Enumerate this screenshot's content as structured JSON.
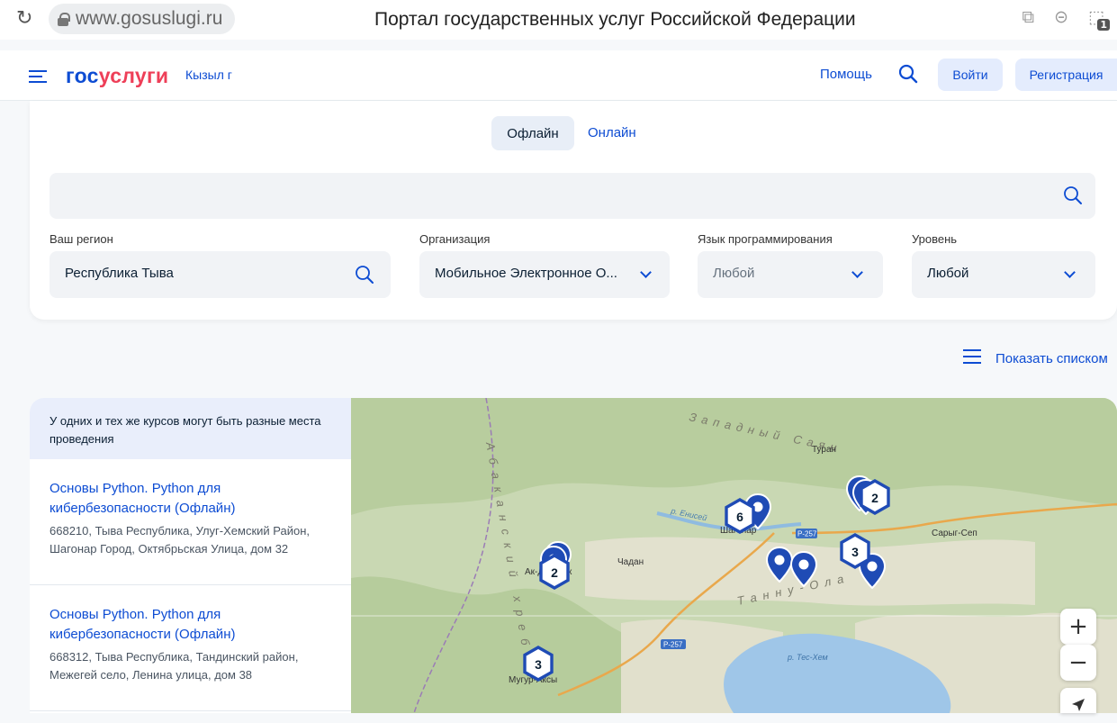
{
  "browser": {
    "url": "www.gosuslugi.ru",
    "page_title": "Портал государственных услуг Российской Федерации",
    "tab_count": "1"
  },
  "header": {
    "logo_part1": "гос",
    "logo_part2": "услуги",
    "city": "Кызыл г",
    "help": "Помощь",
    "login": "Войти",
    "register": "Регистрация"
  },
  "filters": {
    "tab_offline": "Офлайн",
    "tab_online": "Онлайн",
    "search_value": "",
    "region": {
      "label": "Ваш регион",
      "value": "Республика Тыва"
    },
    "organization": {
      "label": "Организация",
      "value": "Мобильное Электронное О..."
    },
    "language": {
      "label": "Язык программирования",
      "value": "Любой"
    },
    "level": {
      "label": "Уровень",
      "value": "Любой"
    },
    "show_list": "Показать списком"
  },
  "list": {
    "note": "У одних и тех же курсов могут быть разные места проведения",
    "courses": [
      {
        "title": "Основы Python. Python для кибербезопасности (Офлайн)",
        "address": "668210, Тыва Республика, Улуг-Хемский Район, Шагонар Город, Октябрьская Улица, дом 32"
      },
      {
        "title": "Основы Python. Python для кибербезопасности (Офлайн)",
        "address": "668312, Тыва Республика, Тандинский район, Межегей село, Ленина улица, дом 38"
      }
    ]
  },
  "map": {
    "labels": {
      "range_west": "Западный Саян",
      "range_abakan": "Абаканский хребет",
      "range_tannu": "Танну-Ола",
      "turan": "Туран",
      "chadan": "Чадан",
      "saryg_sep": "Сарыг-Сеп",
      "enisei": "р. Енисей",
      "tes_hem": "р. Тес-Хем",
      "road1": "Р-257",
      "road2": "Р-257",
      "town_a": "Ак-Довурак",
      "town_m": "Мугур-Аксы",
      "town_s": "Шагонар"
    },
    "clusters": [
      "6",
      "2",
      "3",
      "2",
      "3"
    ],
    "zoom_in": "+",
    "zoom_out": "−"
  },
  "colors": {
    "brand_blue": "#0d4cd3",
    "brand_red": "#ee3f58",
    "marker": "#1f4bb5"
  }
}
